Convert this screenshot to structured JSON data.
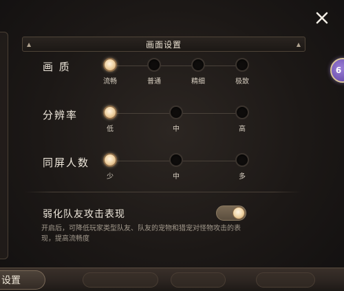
{
  "header": {
    "title": "画面设置"
  },
  "quality": {
    "label": "画 质",
    "options": [
      "流畅",
      "普通",
      "精细",
      "极致"
    ],
    "selected": "流畅"
  },
  "resolution": {
    "label": "分辨率",
    "options": [
      "低",
      "中",
      "高"
    ],
    "selected": "低"
  },
  "players_on_screen": {
    "label": "同屏人数",
    "options": [
      "少",
      "中",
      "多"
    ],
    "selected": "少"
  },
  "weaken_teammate": {
    "title": "弱化队友攻击表现",
    "description": "开启后，可降低玩家类型队友、队友的宠物和猎宠对怪物攻击的表现，提高流畅度",
    "enabled": true
  },
  "bottom_tab": {
    "label": "设置"
  },
  "side_badge": {
    "text": "6"
  },
  "colors": {
    "accent": "#f0d5a8",
    "background": "#1c1816"
  }
}
